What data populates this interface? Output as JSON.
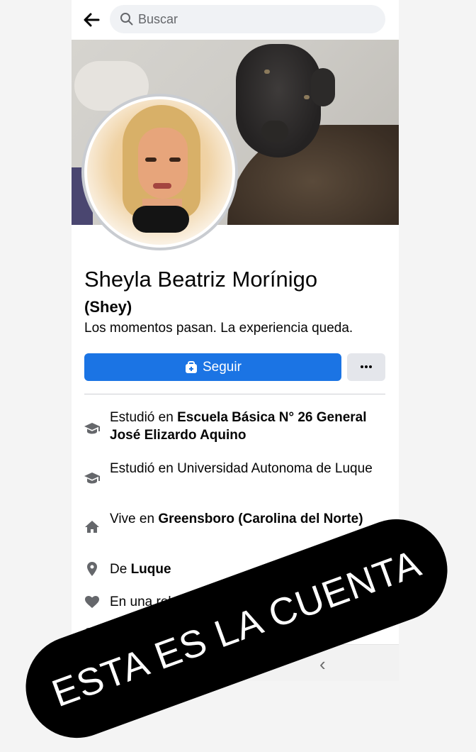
{
  "search": {
    "placeholder": "Buscar"
  },
  "profile": {
    "name": "Sheyla Beatriz Morínigo",
    "nickname": "(Shey)",
    "bio": "Los momentos pasan. La experiencia queda."
  },
  "actions": {
    "follow_label": "Seguir",
    "more_label": "Más opciones"
  },
  "info": [
    {
      "icon": "graduation-cap-icon",
      "prefix": "Estudió en ",
      "bold": "Escuela Básica N° 26 General José Elizardo Aquino",
      "suffix": ""
    },
    {
      "icon": "graduation-cap-icon",
      "prefix": "Estudió en Universidad Autonoma de Luque",
      "bold": "",
      "suffix": ""
    },
    {
      "icon": "home-icon",
      "prefix": "Vive en ",
      "bold": "Greensboro (Carolina del Norte)",
      "suffix": ""
    },
    {
      "icon": "location-pin-icon",
      "prefix": "De ",
      "bold": "Luque",
      "suffix": ""
    },
    {
      "icon": "heart-icon",
      "prefix": "En una relació",
      "bold": "",
      "suffix": ""
    }
  ],
  "banner": {
    "text": "ESTA ES LA CUENTA"
  },
  "colors": {
    "accent": "#1b74e4",
    "banner_bg": "#000000",
    "text": "#050505"
  }
}
